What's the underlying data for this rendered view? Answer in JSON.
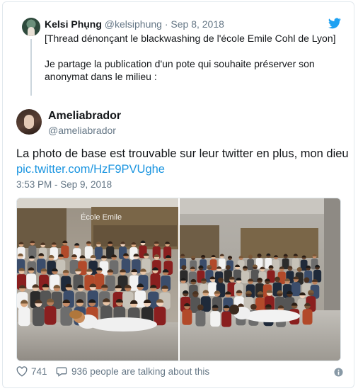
{
  "parent_tweet": {
    "display_name": "Kelsi Phụng",
    "handle": "@kelsiphung",
    "separator": "·",
    "date": "Sep 8, 2018",
    "line1": "[Thread dénonçant le blackwashing de l'école Emile Cohl de Lyon]",
    "line2": "Je partage la publication d'un pote qui souhaite préserver son anonymat dans le milieu :"
  },
  "tweet": {
    "display_name": "Ameliabrador",
    "handle": "@ameliabrador",
    "text": "La photo de base est trouvable sur leur twitter en plus, mon dieu",
    "link": "pic.twitter.com/HzF9PVUghe",
    "timestamp": "3:53 PM - Sep 9, 2018"
  },
  "photo_sign": "École Emile",
  "footer": {
    "likes": "741",
    "talking": "936 people are talking about this"
  },
  "icons": {
    "brand": "twitter-bird-icon",
    "like": "heart-icon",
    "reply": "speech-bubble-icon",
    "info": "info-icon"
  },
  "colors": {
    "link": "#1b95e0",
    "muted": "#657786",
    "text": "#14171a",
    "border": "#e1e8ed"
  }
}
